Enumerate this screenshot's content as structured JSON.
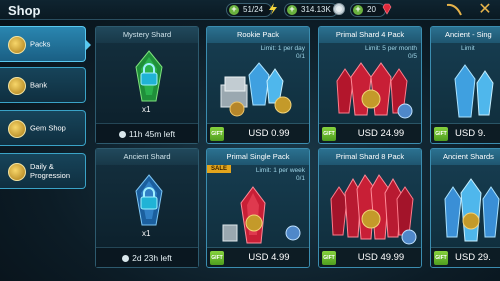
{
  "header": {
    "title": "Shop",
    "energy": "51/24",
    "silver": "314.13K",
    "gems": "20"
  },
  "sidebar": {
    "items": [
      {
        "label": "Packs",
        "active": true
      },
      {
        "label": "Bank",
        "active": false
      },
      {
        "label": "Gem Shop",
        "active": false
      },
      {
        "label": "Daily & Progression",
        "active": false
      }
    ]
  },
  "shards": [
    {
      "title": "Mystery Shard",
      "count": "x1",
      "timer": "11h 45m left"
    },
    {
      "title": "Ancient Shard",
      "count": "x1",
      "timer": "2d 23h left"
    }
  ],
  "packs": [
    {
      "title": "Rookie Pack",
      "limit": "Limit: 1 per day",
      "progress": "0/1",
      "price": "USD 0.99",
      "sale": ""
    },
    {
      "title": "Primal Shard 4 Pack",
      "limit": "Limit: 5 per month",
      "progress": "0/5",
      "price": "USD 24.99",
      "sale": ""
    },
    {
      "title": "Ancient - Sing",
      "limit": "Limit",
      "progress": "",
      "price": "USD 9.",
      "sale": ""
    },
    {
      "title": "Primal Single Pack",
      "limit": "Limit: 1 per week",
      "progress": "0/1",
      "price": "USD 4.99",
      "sale": "SALE"
    },
    {
      "title": "Primal Shard 8 Pack",
      "limit": "",
      "progress": "",
      "price": "USD 49.99",
      "sale": ""
    },
    {
      "title": "Ancient Shards",
      "limit": "",
      "progress": "",
      "price": "USD 29.",
      "sale": ""
    }
  ],
  "colors": {
    "accent": "#3aa3c7",
    "gem": "#e0293a",
    "energy": "#f2d33c",
    "buy": "#6ab23e"
  }
}
